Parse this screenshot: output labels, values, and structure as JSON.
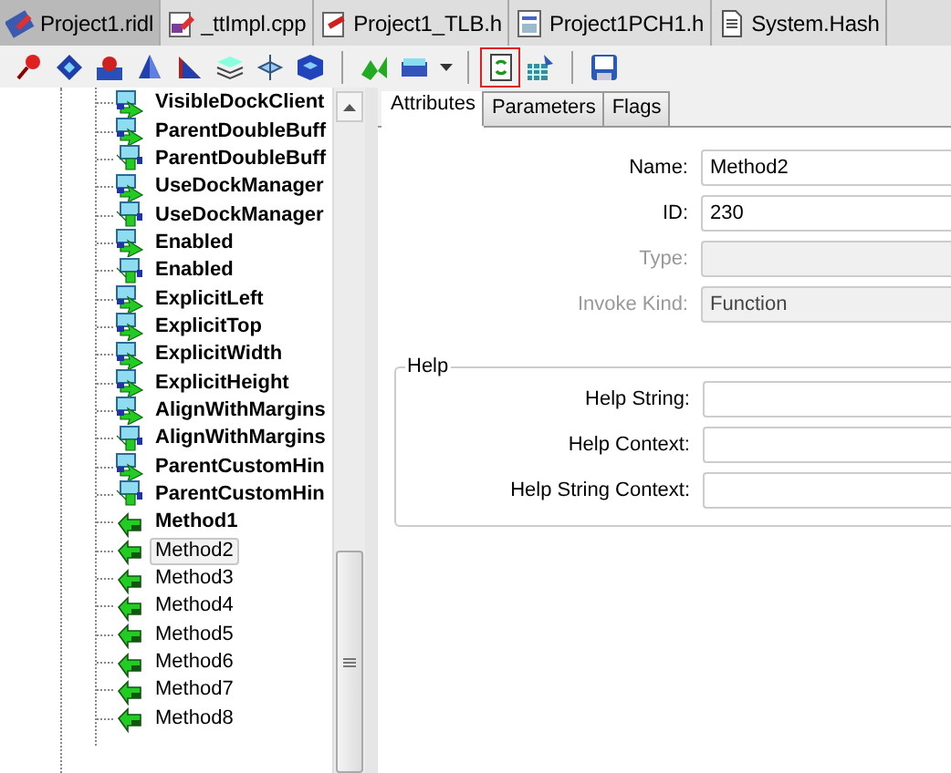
{
  "file_tabs": [
    {
      "label": "Project1.ridl",
      "selected": true
    },
    {
      "label": "_ttImpl.cpp",
      "selected": false
    },
    {
      "label": "Project1_TLB.h",
      "selected": false
    },
    {
      "label": "Project1PCH1.h",
      "selected": false
    },
    {
      "label": "System.Hash",
      "selected": false
    }
  ],
  "toolbar": [
    {
      "kind": "button",
      "highlighted": false
    },
    {
      "kind": "button",
      "highlighted": false
    },
    {
      "kind": "button",
      "highlighted": false
    },
    {
      "kind": "button",
      "highlighted": false
    },
    {
      "kind": "button",
      "highlighted": false
    },
    {
      "kind": "button",
      "highlighted": false
    },
    {
      "kind": "button",
      "highlighted": false
    },
    {
      "kind": "button",
      "highlighted": false
    },
    {
      "kind": "separator"
    },
    {
      "kind": "button",
      "highlighted": false
    },
    {
      "kind": "button",
      "highlighted": false
    },
    {
      "kind": "dropdown"
    },
    {
      "kind": "separator"
    },
    {
      "kind": "button",
      "highlighted": true
    },
    {
      "kind": "button",
      "highlighted": false
    },
    {
      "kind": "separator"
    },
    {
      "kind": "button",
      "highlighted": false
    }
  ],
  "tree": {
    "items": [
      {
        "label": "VisibleDockClient",
        "kind": "property-get",
        "bold": true,
        "selected": false
      },
      {
        "label": "ParentDoubleBuff",
        "kind": "property-get",
        "bold": true,
        "selected": false
      },
      {
        "label": "ParentDoubleBuff",
        "kind": "property-put",
        "bold": true,
        "selected": false
      },
      {
        "label": "UseDockManager",
        "kind": "property-get",
        "bold": true,
        "selected": false
      },
      {
        "label": "UseDockManager",
        "kind": "property-put",
        "bold": true,
        "selected": false
      },
      {
        "label": "Enabled",
        "kind": "property-get",
        "bold": true,
        "selected": false
      },
      {
        "label": "Enabled",
        "kind": "property-put",
        "bold": true,
        "selected": false
      },
      {
        "label": "ExplicitLeft",
        "kind": "property-get",
        "bold": true,
        "selected": false
      },
      {
        "label": "ExplicitTop",
        "kind": "property-get",
        "bold": true,
        "selected": false
      },
      {
        "label": "ExplicitWidth",
        "kind": "property-get",
        "bold": true,
        "selected": false
      },
      {
        "label": "ExplicitHeight",
        "kind": "property-get",
        "bold": true,
        "selected": false
      },
      {
        "label": "AlignWithMargins",
        "kind": "property-get",
        "bold": true,
        "selected": false
      },
      {
        "label": "AlignWithMargins",
        "kind": "property-put",
        "bold": true,
        "selected": false
      },
      {
        "label": "ParentCustomHin",
        "kind": "property-get",
        "bold": true,
        "selected": false
      },
      {
        "label": "ParentCustomHin",
        "kind": "property-put",
        "bold": true,
        "selected": false
      },
      {
        "label": "Method1",
        "kind": "method",
        "bold": true,
        "selected": false
      },
      {
        "label": "Method2",
        "kind": "method",
        "bold": false,
        "selected": true
      },
      {
        "label": "Method3",
        "kind": "method",
        "bold": false,
        "selected": false
      },
      {
        "label": "Method4",
        "kind": "method",
        "bold": false,
        "selected": false
      },
      {
        "label": "Method5",
        "kind": "method",
        "bold": false,
        "selected": false
      },
      {
        "label": "Method6",
        "kind": "method",
        "bold": false,
        "selected": false
      },
      {
        "label": "Method7",
        "kind": "method",
        "bold": false,
        "selected": false
      },
      {
        "label": "Method8",
        "kind": "method",
        "bold": false,
        "selected": false
      }
    ]
  },
  "detail_tabs": [
    {
      "label": "Attributes",
      "selected": true
    },
    {
      "label": "Parameters",
      "selected": false
    },
    {
      "label": "Flags",
      "selected": false
    }
  ],
  "attributes": [
    {
      "label": "Name:",
      "value": "Method2",
      "disabled": false
    },
    {
      "label": "ID:",
      "value": "230",
      "disabled": false
    },
    {
      "label": "Type:",
      "disabled": true
    },
    {
      "label": "Invoke Kind:",
      "value": "Function",
      "disabled": true
    }
  ],
  "help_group": {
    "title": "Help",
    "fields": [
      {
        "label": "Help String:"
      },
      {
        "label": "Help Context:"
      },
      {
        "label": "Help String Context:"
      }
    ]
  }
}
